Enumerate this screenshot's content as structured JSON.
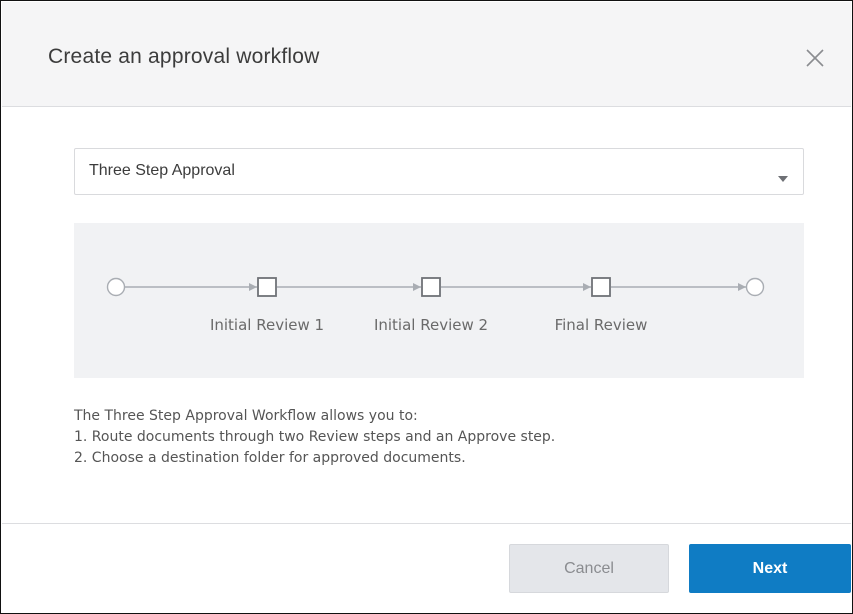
{
  "dialog": {
    "title": "Create an approval workflow",
    "close_icon": "close-icon"
  },
  "workflow_select": {
    "value": "Three Step Approval",
    "caret_icon": "caret-down-icon"
  },
  "diagram": {
    "steps": [
      {
        "label": "Initial Review 1"
      },
      {
        "label": "Initial Review 2"
      },
      {
        "label": "Final Review"
      }
    ],
    "colors": {
      "line": "#a9adb3",
      "node": "#7a7d82"
    }
  },
  "description": {
    "lines": [
      "The Three Step Approval Workflow allows you to:",
      "1. Route documents through two Review steps and an Approve step.",
      "2. Choose a destination folder for approved documents."
    ]
  },
  "buttons": {
    "cancel_label": "Cancel",
    "next_label": "Next"
  },
  "colors": {
    "accent": "#0f7cc4",
    "header_bg": "#f5f5f6",
    "diagram_bg": "#f1f2f4"
  }
}
